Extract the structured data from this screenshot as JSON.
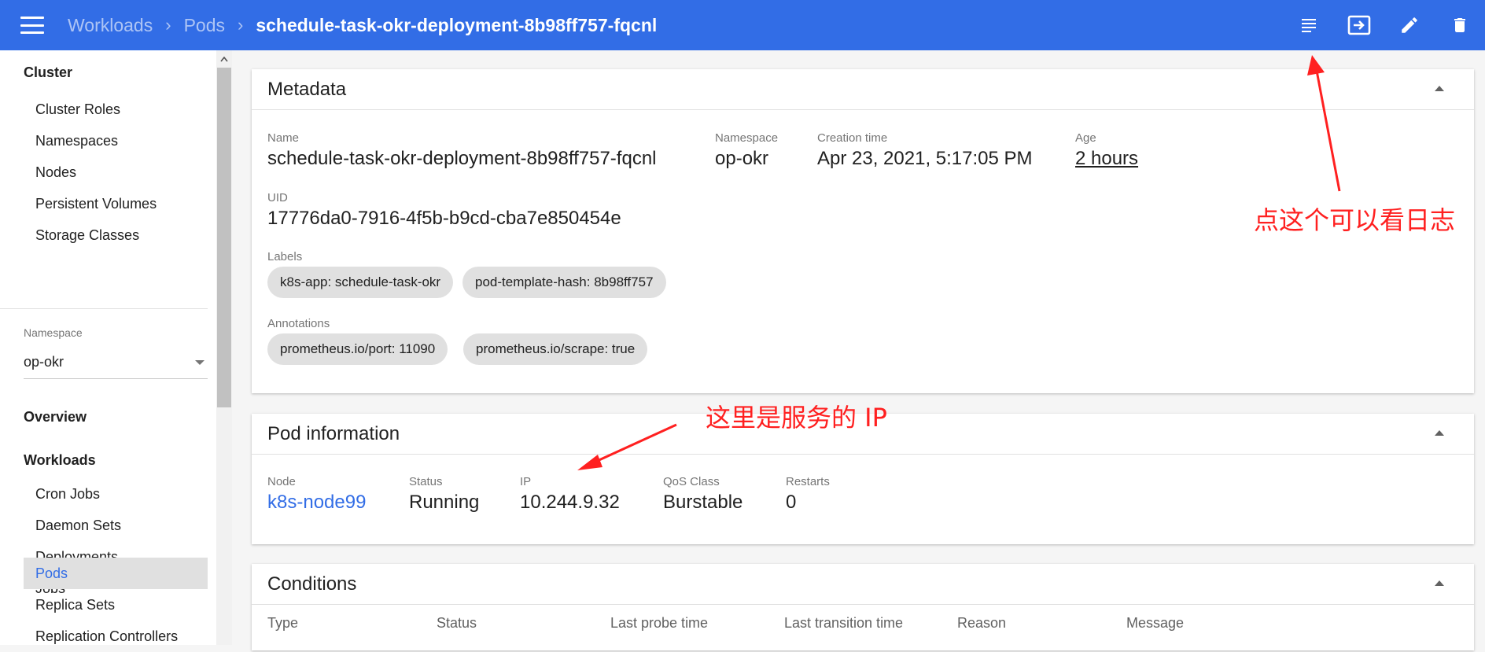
{
  "breadcrumb": {
    "items": [
      "Workloads",
      "Pods"
    ],
    "current": "schedule-task-okr-deployment-8b98ff757-fqcnl"
  },
  "actions": [
    "logs-icon",
    "exec-icon",
    "edit-icon",
    "delete-icon"
  ],
  "sidebar": {
    "cluster_heading": "Cluster",
    "cluster_items": [
      "Cluster Roles",
      "Namespaces",
      "Nodes",
      "Persistent Volumes",
      "Storage Classes"
    ],
    "namespace_label": "Namespace",
    "namespace_value": "op-okr",
    "overview": "Overview",
    "workloads_heading": "Workloads",
    "workload_items": [
      "Cron Jobs",
      "Daemon Sets",
      "Deployments",
      "Jobs",
      "Pods",
      "Replica Sets",
      "Replication Controllers"
    ],
    "active_item": "Pods"
  },
  "metadata": {
    "title": "Metadata",
    "name_label": "Name",
    "name": "schedule-task-okr-deployment-8b98ff757-fqcnl",
    "namespace_label": "Namespace",
    "namespace": "op-okr",
    "creation_label": "Creation time",
    "creation": "Apr 23, 2021, 5:17:05 PM",
    "age_label": "Age",
    "age": "2 hours",
    "uid_label": "UID",
    "uid": "17776da0-7916-4f5b-b9cd-cba7e850454e",
    "labels_label": "Labels",
    "labels": [
      "k8s-app: schedule-task-okr",
      "pod-template-hash: 8b98ff757"
    ],
    "annotations_label": "Annotations",
    "annotations": [
      "prometheus.io/port: 11090",
      "prometheus.io/scrape: true"
    ]
  },
  "pod_info": {
    "title": "Pod information",
    "node_label": "Node",
    "node": "k8s-node99",
    "status_label": "Status",
    "status": "Running",
    "ip_label": "IP",
    "ip": "10.244.9.32",
    "qos_label": "QoS Class",
    "qos": "Burstable",
    "restarts_label": "Restarts",
    "restarts": "0"
  },
  "conditions": {
    "title": "Conditions",
    "columns": [
      "Type",
      "Status",
      "Last probe time",
      "Last transition time",
      "Reason",
      "Message"
    ]
  },
  "annotations_overlay": {
    "logs_note": "点这个可以看日志",
    "ip_note": "这里是服务的 IP",
    "color": "#ff2020"
  },
  "colors": {
    "primary": "#326de6",
    "active_bg": "#e0e0e0"
  }
}
